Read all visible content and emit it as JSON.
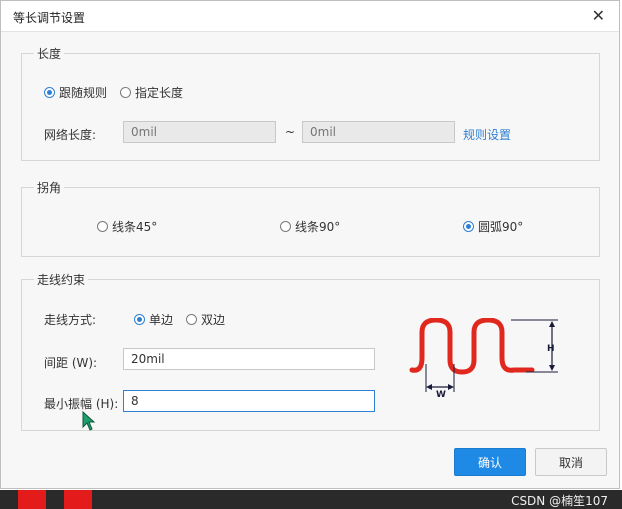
{
  "dialog": {
    "title": "等长调节设置"
  },
  "length": {
    "legend": "长度",
    "options": [
      {
        "label": "跟随规则",
        "selected": true
      },
      {
        "label": "指定长度",
        "selected": false
      }
    ],
    "net_length_label": "网络长度:",
    "min_placeholder": "0mil",
    "separator": "~",
    "max_placeholder": "0mil",
    "rule_link": "规则设置"
  },
  "corner": {
    "legend": "拐角",
    "options": [
      {
        "label": "线条45°",
        "selected": false
      },
      {
        "label": "线条90°",
        "selected": false
      },
      {
        "label": "圆弧90°",
        "selected": true
      }
    ]
  },
  "routing": {
    "legend": "走线约束",
    "mode_label": "走线方式:",
    "mode_options": [
      {
        "label": "单边",
        "selected": true
      },
      {
        "label": "双边",
        "selected": false
      }
    ],
    "spacing_label": "间距 (W):",
    "spacing_value": "20mil",
    "amplitude_label": "最小振幅 (H):",
    "amplitude_value": "8",
    "diagram": {
      "w_label": "W",
      "h_label": "H",
      "wave_color": "#e0281e"
    }
  },
  "buttons": {
    "ok": "确认",
    "cancel": "取消"
  },
  "watermark": "CSDN @楠笙107",
  "colors": {
    "accent": "#1e8ae6",
    "wave": "#e0281e"
  }
}
